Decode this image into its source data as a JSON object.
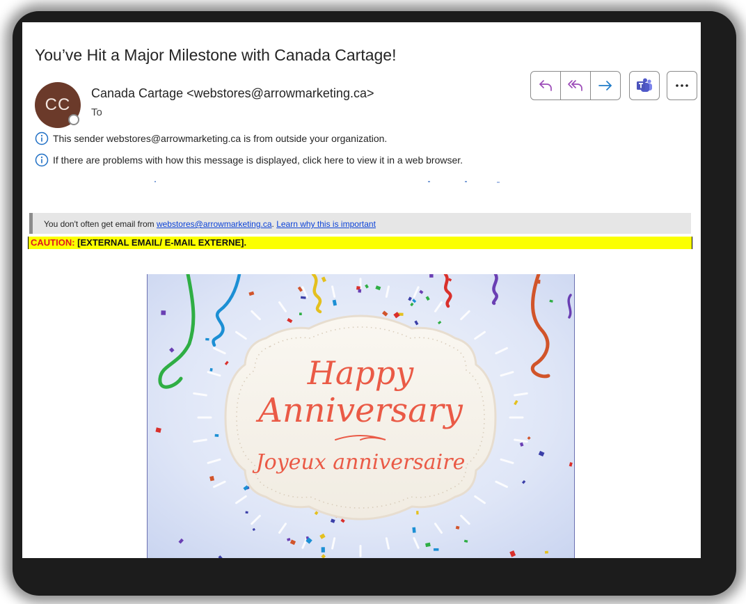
{
  "email": {
    "subject": "You’ve Hit a Major Milestone with Canada Cartage!",
    "avatar_initials": "CC",
    "sender": "Canada Cartage <webstores@arrowmarketing.ca>",
    "to_label": "To"
  },
  "notices": {
    "external_sender": "This sender webstores@arrowmarketing.ca is from outside your organization.",
    "display_problem": "If there are problems with how this message is displayed, click here to view it in a web browser."
  },
  "safety_bar": {
    "prefix": "You don't often get email from ",
    "email_link": "webstores@arrowmarketing.ca",
    "separator": ". ",
    "learn_link": "Learn why this is important"
  },
  "caution": {
    "label": "CAUTION:",
    "text": " [EXTERNAL EMAIL/ E-MAIL EXTERNE]."
  },
  "banner": {
    "line1": "Happy",
    "line2": "Anniversary",
    "line3": "Joyeux anniversaire"
  },
  "toolbar": {
    "icons": [
      "reply-icon",
      "reply-all-icon",
      "forward-icon",
      "teams-icon",
      "more-icon"
    ]
  },
  "colors": {
    "avatar": "#6b3a2a",
    "accent_purple": "#9c4bb8",
    "forward_blue": "#1f7bc8",
    "teams": "#4b53bc",
    "caution_yellow": "#fbff00",
    "caution_red": "#e0141e",
    "banner_text": "#ea5a46"
  }
}
